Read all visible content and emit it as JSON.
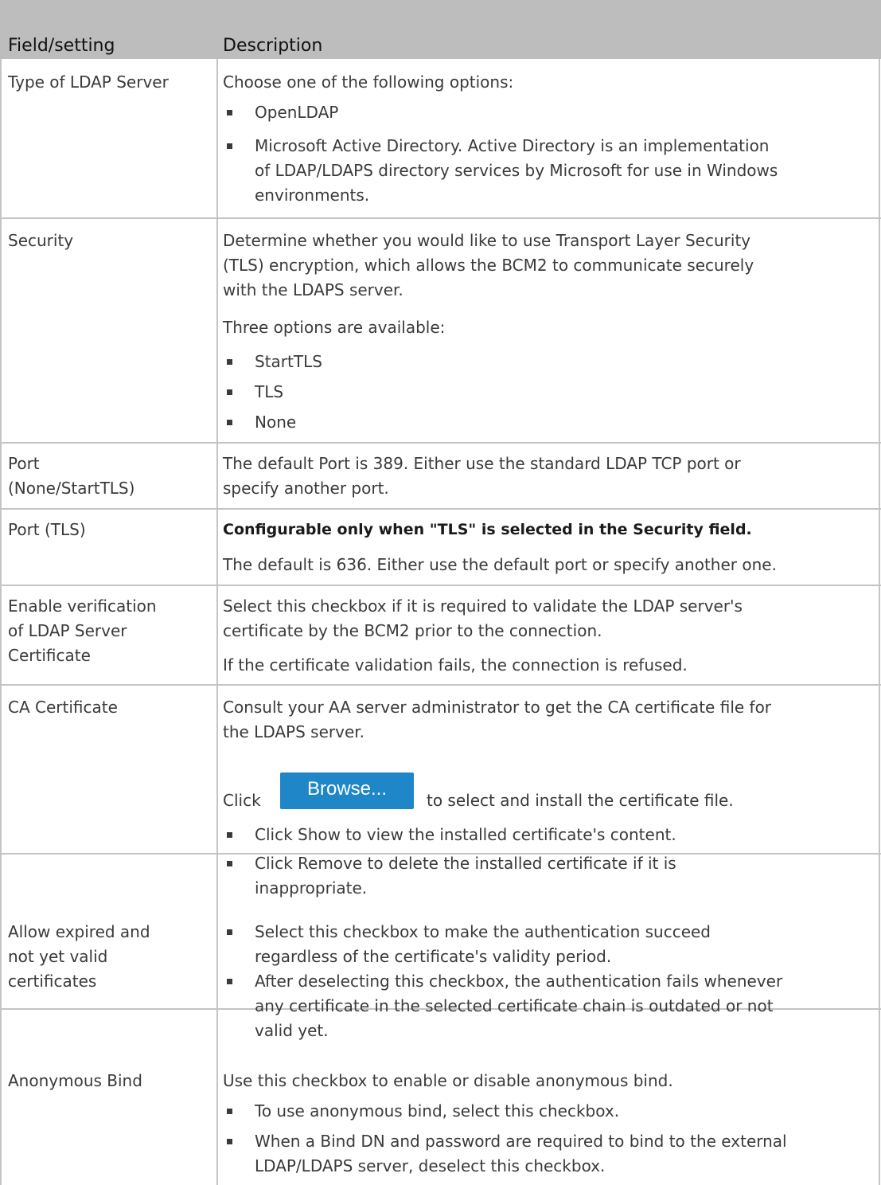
{
  "header": {
    "col1": "Field/setting",
    "col2": "Description"
  },
  "rows": {
    "ldap_type": {
      "field": "Type of LDAP Server",
      "intro": "Choose one of the following options:",
      "b1": "OpenLDAP",
      "b2_l1": "Microsoft Active Directory. Active Directory is an implementation",
      "b2_l2": "of LDAP/LDAPS directory services by Microsoft for use in Windows",
      "b2_l3": "environments."
    },
    "security": {
      "field": "Security",
      "p1_l1": "Determine whether you would like to use Transport Layer Security",
      "p1_l2": "(TLS) encryption, which allows the BCM2 to communicate securely",
      "p1_l3": "with the LDAPS server.",
      "p2": "Three options are available:",
      "b1": "StartTLS",
      "b2": "TLS",
      "b3": "None"
    },
    "port_none": {
      "field_l1": "Port",
      "field_l2": "(None/StartTLS)",
      "l1": "The default Port is 389. Either use the standard LDAP TCP port or",
      "l2": "specify another port."
    },
    "port_tls": {
      "field": "Port (TLS)",
      "note": "Configurable only when \"TLS\" is selected in the Security field.",
      "l1": "The default is 636. Either use the default port or specify another one."
    },
    "verify": {
      "field_l1": "Enable verification",
      "field_l2": "of LDAP Server",
      "field_l3": "Certificate",
      "l1": "Select this checkbox if it is required to validate the LDAP server's",
      "l2": "certificate by the BCM2 prior to the connection.",
      "l3": "If the certificate validation fails, the connection is refused."
    },
    "ca_cert": {
      "field": "CA Certificate",
      "l1": "Consult your AA server administrator to get the CA certificate file for",
      "l2": "the LDAPS server.",
      "click": "Click",
      "browse": "Browse...",
      "after_browse": "to select and install the certificate file.",
      "b1": "Click Show to view the installed certificate's content.",
      "b2_l1": "Click Remove to delete the installed certificate if it is",
      "b2_l2": "inappropriate."
    },
    "expired": {
      "field_l1": "Allow expired and",
      "field_l2": "not yet valid",
      "field_l3": "certificates",
      "b1_l1": "Select this checkbox to make the authentication succeed",
      "b1_l2": "regardless of the certificate's validity period.",
      "b2_l1": "After deselecting this checkbox, the authentication fails whenever",
      "b2_l2": "any certificate in the selected certificate chain is outdated or not",
      "b2_l3": "valid yet."
    },
    "anon": {
      "field": "Anonymous Bind",
      "l1": "Use this checkbox to enable or disable anonymous bind.",
      "b1": "To use anonymous bind, select this checkbox.",
      "b2_l1": "When a Bind DN and password are required to bind to the external",
      "b2_l2": "LDAP/LDAPS server, deselect this checkbox."
    }
  },
  "colors": {
    "header_bg": "#bdbdbd",
    "rule": "#c4c4c4",
    "button": "#1f87c8",
    "text": "#3a3a3a"
  }
}
